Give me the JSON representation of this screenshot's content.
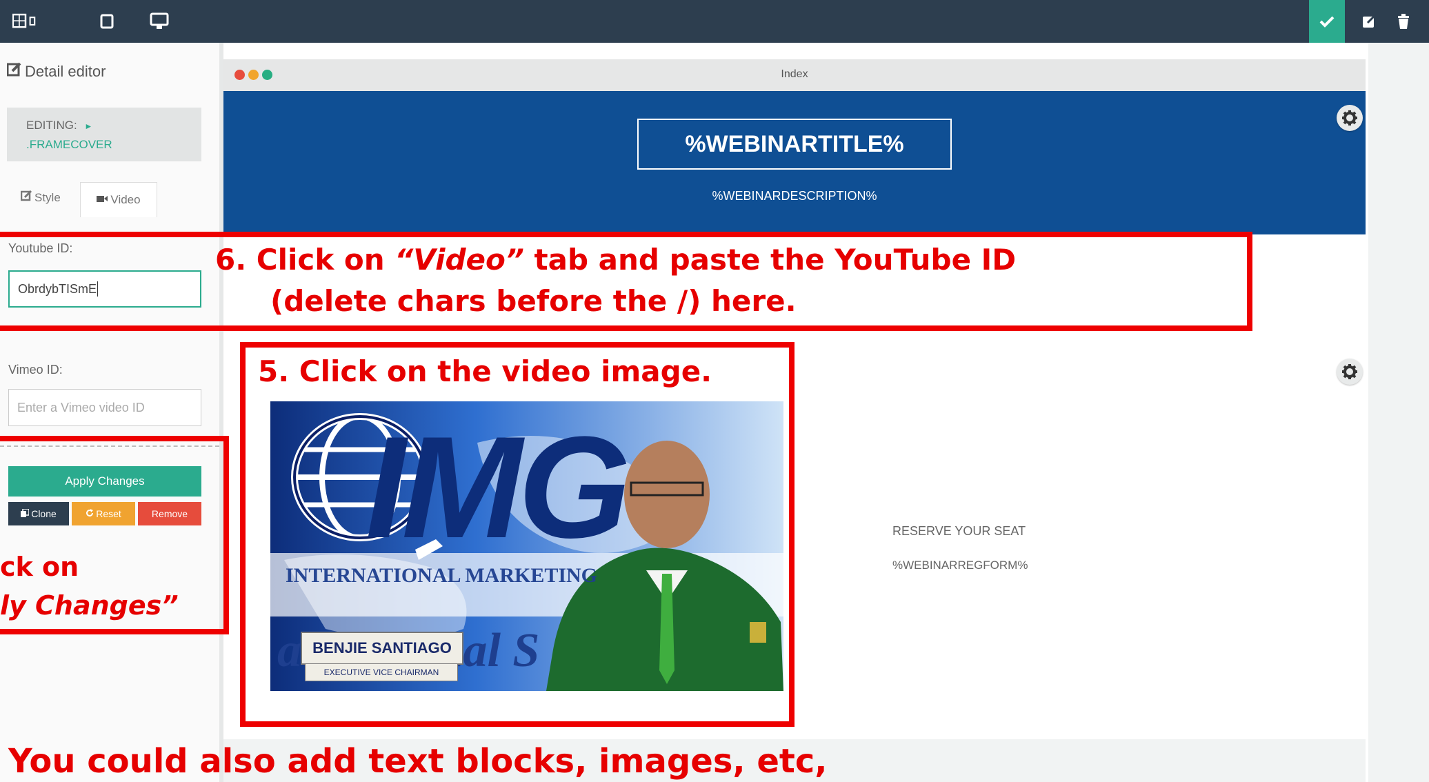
{
  "toolbar": {
    "left_icons": [
      "grid-mobile-icon",
      "tablet-icon",
      "desktop-icon"
    ],
    "right_icons": [
      "check-icon",
      "external-link-icon",
      "trash-icon"
    ],
    "colors": {
      "bar": "#2d3e4f",
      "check_bg": "#2bab8e"
    }
  },
  "sidebar": {
    "title": "Detail editor",
    "editing_label": "EDITING:",
    "editing_arrow": "►",
    "editing_target": ".FRAMECOVER",
    "tabs": [
      {
        "label": "Style"
      },
      {
        "label": "Video"
      }
    ],
    "youtube_label": "Youtube ID:",
    "youtube_value": "ObrdybTISmE",
    "vimeo_label": "Vimeo ID:",
    "vimeo_placeholder": "Enter a Vimeo video ID",
    "apply_label": "Apply Changes",
    "clone_label": "Clone",
    "reset_label": "Reset",
    "remove_label": "Remove",
    "colors": {
      "accent": "#2bab8e",
      "clone": "#2d3e4f",
      "reset": "#f0a330",
      "remove": "#e64c3c"
    }
  },
  "canvas": {
    "browser_title": "Index",
    "dots": [
      "#e74c3c",
      "#f1a52c",
      "#27ae82"
    ],
    "webinar_title": "%WEBINARTITLE%",
    "webinar_description": "%WEBINARDESCRIPTION%",
    "reserve_text": "RESERVE YOUR SEAT",
    "regform_text": "%WEBINARREGFORM%",
    "video": {
      "logo_text": "IMG",
      "company_text": "INTERNATIONAL MARKETING",
      "script_text": "ial S",
      "script_prefix": "a",
      "name_text": "BENJIE SANTIAGO",
      "role_text": "EXECUTIVE VICE CHAIRMAN"
    }
  },
  "annotations": {
    "step6_line1_a": "6. Click on ",
    "step6_line1_b": "“Video”",
    "step6_line1_c": " tab and paste the YouTube ID",
    "step6_line2": "(delete chars before the /) here.",
    "step5": "5. Click on the video image.",
    "step7_line1": "ck on",
    "step7_line2": "ly Changes”",
    "footer": "You could also add text blocks, images, etc,"
  }
}
